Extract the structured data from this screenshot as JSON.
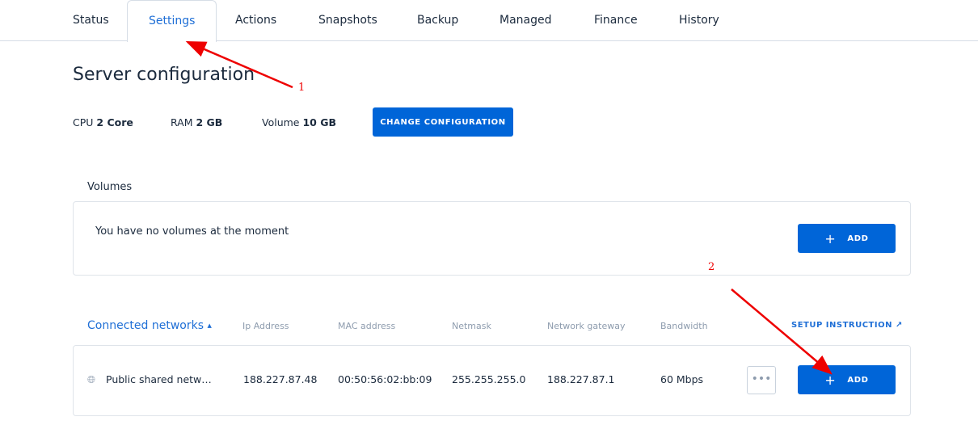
{
  "tabs": [
    {
      "label": "Status"
    },
    {
      "label": "Settings"
    },
    {
      "label": "Actions"
    },
    {
      "label": "Snapshots"
    },
    {
      "label": "Backup"
    },
    {
      "label": "Managed"
    },
    {
      "label": "Finance"
    },
    {
      "label": "History"
    }
  ],
  "page_title": "Server configuration",
  "config": {
    "cpu_label": "CPU",
    "cpu_value": "2 Core",
    "ram_label": "RAM",
    "ram_value": "2 GB",
    "volume_label": "Volume",
    "volume_value": "10 GB",
    "change_button": "CHANGE CONFIGURATION"
  },
  "volumes": {
    "title": "Volumes",
    "empty_text": "You have no volumes at the moment",
    "add_button": "ADD"
  },
  "networks": {
    "title": "Connected networks",
    "columns": [
      "Ip Address",
      "MAC address",
      "Netmask",
      "Network gateway",
      "Bandwidth"
    ],
    "setup_link": "SETUP INSTRUCTION",
    "rows": [
      {
        "name": "Public shared netw…",
        "ip": "188.227.87.48",
        "mac": "00:50:56:02:bb:09",
        "netmask": "255.255.255.0",
        "gateway": "188.227.87.1",
        "bandwidth": "60 Mbps"
      }
    ],
    "more_button": "•••",
    "add_button": "ADD"
  },
  "annotations": [
    "1",
    "2"
  ],
  "colors": {
    "accent": "#0065d8",
    "annotation": "#ee0000"
  }
}
